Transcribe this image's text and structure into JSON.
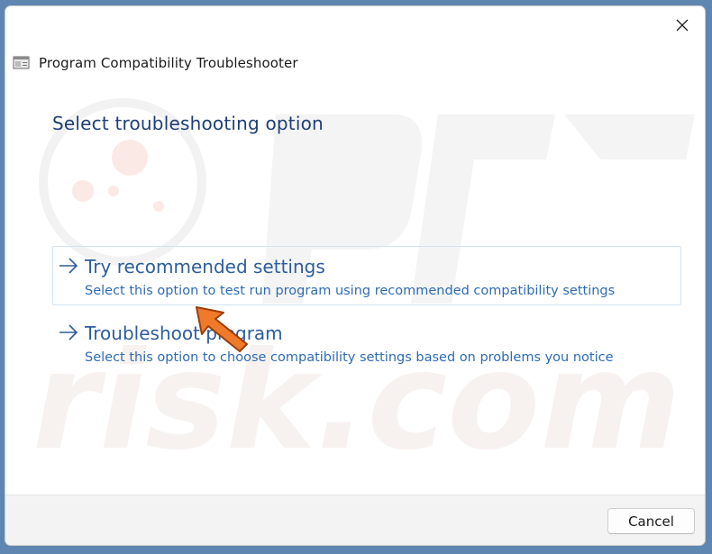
{
  "window": {
    "title": "Program Compatibility Troubleshooter",
    "close_icon": "close-icon",
    "app_icon": "troubleshooter-app-icon"
  },
  "page": {
    "heading": "Select troubleshooting option"
  },
  "options": [
    {
      "title": "Try recommended settings",
      "description": "Select this option to test run program using recommended compatibility settings",
      "icon": "arrow-right-icon",
      "hovered": true
    },
    {
      "title": "Troubleshoot program",
      "description": "Select this option to choose compatibility settings based on problems you notice",
      "icon": "arrow-right-icon",
      "hovered": false
    }
  ],
  "footer": {
    "cancel_label": "Cancel"
  },
  "annotation": {
    "icon": "orange-pointer-arrow-icon",
    "color": "#f07a2a"
  },
  "colors": {
    "heading": "#1f3e76",
    "option_title": "#2e5d9b",
    "option_description": "#2f6bb3",
    "desktop_background": "#5f86b0"
  }
}
